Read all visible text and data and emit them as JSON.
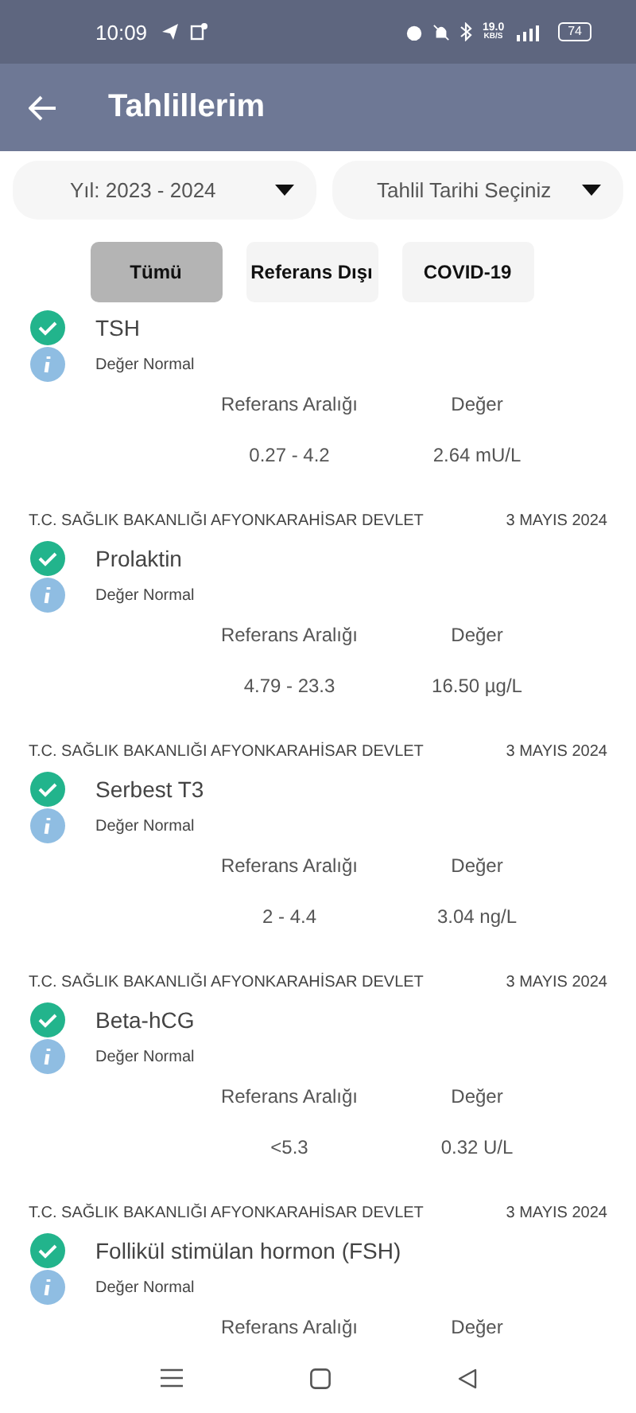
{
  "status_bar": {
    "time": "10:09",
    "speed": "19.0",
    "speed_unit": "KB/S",
    "battery": "74"
  },
  "app_bar": {
    "title": "Tahlillerim"
  },
  "dropdowns": [
    {
      "label": "Yıl: 2023 - 2024"
    },
    {
      "label": "Tahlil Tarihi Seçiniz"
    }
  ],
  "filters": [
    {
      "label": "Tümü",
      "selected": true
    },
    {
      "label": "Referans Dışı",
      "selected": false
    },
    {
      "label": "COVID-19",
      "selected": false
    }
  ],
  "results": [
    {
      "name": "TSH",
      "status": "Değer Normal",
      "normal": true,
      "range_label": "Referans Aralığı",
      "value_label": "Değer",
      "range": "0.27 - 4.2",
      "value": "2.64 mU/L"
    },
    {
      "institution": "T.C. SAĞLIK BAKANLIĞI AFYONKARAHİSAR DEVLET",
      "date": "3 MAYIS 2024",
      "name": "Prolaktin",
      "status": "Değer Normal",
      "normal": true,
      "range_label": "Referans Aralığı",
      "value_label": "Değer",
      "range": "4.79 - 23.3",
      "value": "16.50 µg/L"
    },
    {
      "institution": "T.C. SAĞLIK BAKANLIĞI AFYONKARAHİSAR DEVLET",
      "date": "3 MAYIS 2024",
      "name": "Serbest T3",
      "status": "Değer Normal",
      "normal": true,
      "range_label": "Referans Aralığı",
      "value_label": "Değer",
      "range": "2 - 4.4",
      "value": "3.04 ng/L"
    },
    {
      "institution": "T.C. SAĞLIK BAKANLIĞI AFYONKARAHİSAR DEVLET",
      "date": "3 MAYIS 2024",
      "name": "Beta-hCG",
      "status": "Değer Normal",
      "normal": true,
      "range_label": "Referans Aralığı",
      "value_label": "Değer",
      "range": "<5.3",
      "value": "0.32 U/L"
    },
    {
      "institution": "T.C. SAĞLIK BAKANLIĞI AFYONKARAHİSAR DEVLET",
      "date": "3 MAYIS 2024",
      "name": "Follikül stimülan hormon (FSH)",
      "status": "Değer Normal",
      "normal": true,
      "range_label": "Referans Aralığı",
      "value_label": "Değer"
    }
  ]
}
